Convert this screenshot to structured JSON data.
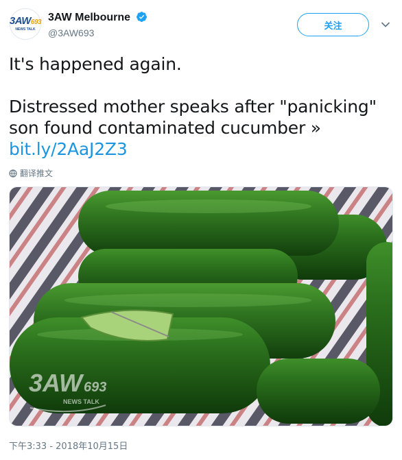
{
  "account": {
    "avatar_text": "3AW",
    "avatar_text_num": "693",
    "avatar_subtext": "NEWS TALK",
    "display_name": "3AW Melbourne",
    "handle": "@3AW693"
  },
  "actions": {
    "follow_label": "关注"
  },
  "tweet": {
    "line1": "It's happened again.",
    "line2": "Distressed mother speaks after \"panicking\" son found  contaminated cucumber »",
    "link": "bit.ly/2AaJ2Z3",
    "translate_label": "翻译推文",
    "timestamp": "下午3:33 - 2018年10月15日"
  },
  "media": {
    "watermark_main": "3AW",
    "watermark_num": "693",
    "watermark_sub": "NEWS TALK"
  },
  "colors": {
    "accent": "#1da1f2",
    "link": "#1b95e0",
    "secondary_text": "#657786"
  }
}
